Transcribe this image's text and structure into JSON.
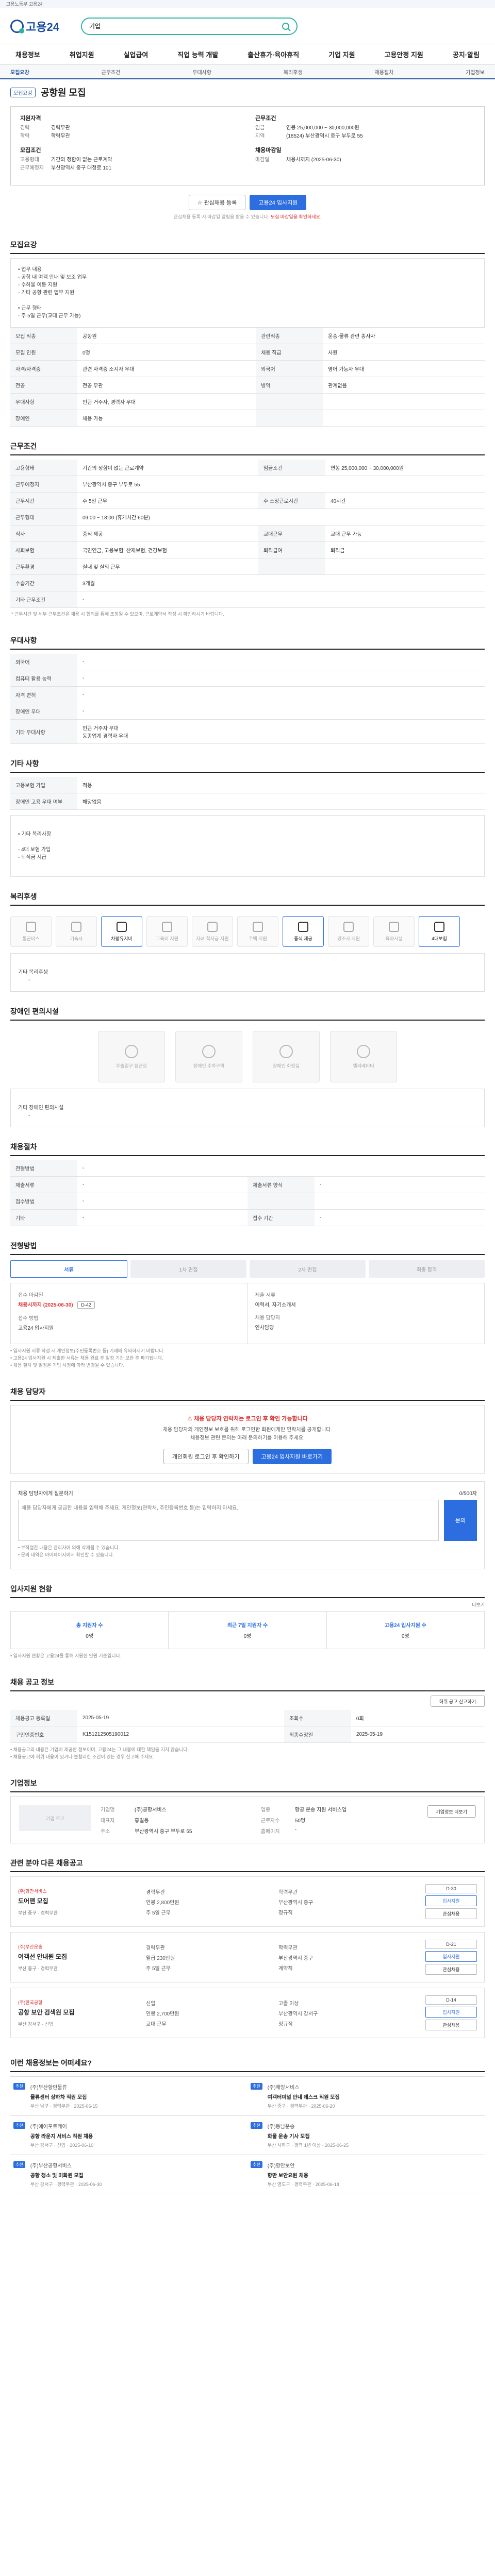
{
  "topbar": {
    "text": "고용노동부 고용24"
  },
  "header": {
    "logo": "고용24",
    "search_placeholder": "기업"
  },
  "nav": [
    "채용정보",
    "취업지원",
    "실업급여",
    "직업 능력 개발",
    "출산휴가·육아휴직",
    "기업 지원",
    "고용안정 지원",
    "공지·알림"
  ],
  "subnav": {
    "items": [
      "모집요강",
      "근무조건",
      "우대사항",
      "복리후생",
      "채용절차",
      "기업정보"
    ],
    "active": 0
  },
  "title": {
    "badge": "모집요강",
    "text": "공항원 모집"
  },
  "summary": {
    "left_title": "지원자격",
    "left": [
      {
        "k": "경력",
        "v": "경력무관"
      },
      {
        "k": "학력",
        "v": "학력무관"
      }
    ],
    "left_title2": "모집조건",
    "left2": [
      {
        "k": "고용형태",
        "v": "기간의 정함이 없는 근로계약"
      },
      {
        "k": "근무예정지",
        "v": "부산광역시 중구 대청로 101"
      }
    ],
    "right_title": "근무조건",
    "right": [
      {
        "k": "임금",
        "v": "연봉 25,000,000 ~ 30,000,000원"
      },
      {
        "k": "지역",
        "v": "(18524) 부산광역시 중구 부두로 55"
      }
    ],
    "right_title2": "채용마감일",
    "right2": [
      {
        "k": "마감일",
        "v": "채용시까지 (2025-06-30)"
      }
    ]
  },
  "actions": {
    "scrap": "관심채용 등록",
    "apply": "고용24 입사지원"
  },
  "apply_note": {
    "pre": "관심채용 등록 시 마감일 알림을 받을 수 있습니다.",
    "red": " 모집 마감일을 확인하세요."
  },
  "recruit": {
    "title": "모집요강",
    "job_desc": "• 업무 내용\n - 공항 내 여객 안내 및 보조 업무\n - 수하물 이동 지원\n - 기타 공항 관련 업무 지원\n\n• 근무 형태\n - 주 5일 근무(교대 근무 가능)",
    "rows": [
      {
        "k": "모집 직종",
        "v": "공항원",
        "k2": "관련직종",
        "v2": "운송·물류 관련 종사자"
      },
      {
        "k": "모집 인원",
        "v": "0명",
        "k2": "채용 직급",
        "v2": "사원"
      },
      {
        "k": "자격/자격증",
        "v": "관련 자격증 소지자 우대",
        "k2": "외국어",
        "v2": "영어 가능자 우대"
      },
      {
        "k": "전공",
        "v": "전공 무관",
        "k2": "병역",
        "v2": "관계없음"
      },
      {
        "k": "우대사항",
        "v": "인근 거주자, 경력자 우대",
        "k2": "",
        "v2": ""
      },
      {
        "k": "장애인",
        "v": "채용 가능",
        "k2": "",
        "v2": ""
      }
    ]
  },
  "conditions": {
    "title": "근무조건",
    "rows": [
      {
        "k": "고용형태",
        "v": "기간의 정함이 없는 근로계약",
        "k2": "임금조건",
        "v2": "연봉 25,000,000 ~ 30,000,000원"
      },
      {
        "k": "근무예정지",
        "v": "부산광역시 중구 부두로 55"
      },
      {
        "k": "근무시간",
        "v": "주 5일 근무",
        "k2": "주 소정근로시간",
        "v2": "40시간"
      },
      {
        "k": "근무형태",
        "v": "09:00 ~ 18:00 (휴게시간 60분)"
      },
      {
        "k": "식사",
        "v": "중식 제공",
        "k2": "교대근무",
        "v2": "교대 근무 가능"
      },
      {
        "k": "사회보험",
        "v": "국민연금, 고용보험, 산재보험, 건강보험",
        "k2": "퇴직급여",
        "v2": "퇴직금"
      },
      {
        "k": "근무환경",
        "v": "실내 및 실외 근무",
        "k2": "",
        "v2": ""
      },
      {
        "k": "수습기간",
        "v": "3개월"
      },
      {
        "k": "기타 근무조건",
        "v": "-"
      }
    ],
    "footnote": "* 근무시간 및 세부 근무조건은 채용 시 협의를 통해 조정될 수 있으며, 근로계약서 작성 시 확인하시기 바랍니다."
  },
  "preferred": {
    "title": "우대사항",
    "rows": [
      {
        "k": "외국어",
        "v": "-"
      },
      {
        "k": "컴퓨터 활용 능력",
        "v": "-"
      },
      {
        "k": "자격 면허",
        "v": "-"
      },
      {
        "k": "장애인 우대",
        "v": "-"
      },
      {
        "k": "기타 우대사항",
        "v": "인근 거주자 우대\n동종업계 경력자 우대"
      }
    ]
  },
  "extra": {
    "title": "기타 사항",
    "rows": [
      {
        "k": "고용보험 가입",
        "v": "적용"
      },
      {
        "k": "장애인 고용 우대 여부",
        "v": "해당없음"
      }
    ],
    "note_label": "• 기타 복리사항",
    "note": "- 4대 보험 가입\n- 퇴직금 지급"
  },
  "welfare": {
    "title": "복리후생",
    "icons": [
      {
        "label": "통근버스",
        "on": false
      },
      {
        "label": "기숙사",
        "on": false
      },
      {
        "label": "차량유지비",
        "on": true
      },
      {
        "label": "교육비 지원",
        "on": false
      },
      {
        "label": "자녀 학자금 지원",
        "on": false
      },
      {
        "label": "주택 지원",
        "on": false
      },
      {
        "label": "중식 제공",
        "on": true
      },
      {
        "label": "경조사 지원",
        "on": false
      },
      {
        "label": "육아시설",
        "on": false
      },
      {
        "label": "4대보험",
        "on": true
      }
    ],
    "extra_label": "기타 복리후생",
    "extra_value": "-"
  },
  "disability": {
    "title": "장애인 편의시설",
    "tiles": [
      "주출입구 접근로",
      "장애인 주차구역",
      "장애인 화장실",
      "엘리베이터"
    ],
    "extra_label": "기타 장애인 편의시설",
    "extra_value": "-"
  },
  "process": {
    "title": "채용절차",
    "rows": [
      {
        "k": "전형방법",
        "v": "-"
      },
      {
        "k": "제출서류",
        "v": "-",
        "k2": "제출서류 양식",
        "v2": "-"
      },
      {
        "k": "접수방법",
        "v": "-",
        "k2": "",
        "v2": ""
      },
      {
        "k": "기타",
        "v": "-",
        "k2": "접수 기간",
        "v2": "-"
      }
    ]
  },
  "apply_steps": {
    "title": "전형방법",
    "steps": [
      "서류",
      "1차 면접",
      "2차 면접",
      "최종 합격"
    ],
    "active": 0,
    "panel": {
      "receipt_label": "접수 마감일",
      "receipt_value": "채용시까지 (2025-06-30)",
      "receipt_remain": "D-42",
      "method_label": "접수 방법",
      "method_value": "고용24 입사지원",
      "doc_label": "제출 서류",
      "doc_value": "이력서, 자기소개서",
      "contact_label": "채용 담당자",
      "contact_value": "인사담당"
    },
    "notes": [
      "• 입사지원 서류 작성 시 개인정보(주민등록번호 등) 기재에 유의하시기 바랍니다.",
      "• 고용24 입사지원 시 제출한 서류는 채용 완료 후 일정 기간 보관 후 파기됩니다.",
      "• 채용 절차 및 일정은 기업 사정에 따라 변경될 수 있습니다."
    ]
  },
  "contact": {
    "title": "채용 담당자",
    "warn_title": "채용 담당자 연락처는 로그인 후 확인 가능합니다",
    "warn_body": "채용 담당자의 개인정보 보호를 위해 로그인한 회원에게만 연락처를 공개합니다.\n채용정보 관련 문의는 아래 문의하기를 이용해 주세요.",
    "btn_login": "개인회원 로그인 후 확인하기",
    "btn_apply": "고용24 입사지원 바로가기"
  },
  "inquiry": {
    "title": "채용 담당자에게 질문하기",
    "counter": "0/500자",
    "placeholder": "채용 담당자에게 궁금한 내용을 입력해 주세요. 개인정보(연락처, 주민등록번호 등)는 입력하지 마세요.",
    "send": "문의",
    "notes": [
      "• 부적절한 내용은 관리자에 의해 삭제될 수 있습니다.",
      "• 문의 내역은 마이페이지에서 확인할 수 있습니다."
    ]
  },
  "apply_methods": {
    "title": "입사지원 현황",
    "more": "더보기",
    "items": [
      {
        "t": "총 지원자 수",
        "v": "0명"
      },
      {
        "t": "최근 7일 지원자 수",
        "v": "0명"
      },
      {
        "t": "고용24 입사지원 수",
        "v": "0명"
      }
    ],
    "note": "• 입사지원 현황은 고용24를 통해 지원한 인원 기준입니다."
  },
  "posting": {
    "title": "채용 공고 정보",
    "report": "허위 공고 신고하기",
    "rows": [
      {
        "k": "채용공고 등록일",
        "v": "2025-05-19",
        "k2": "조회수",
        "v2": "0회"
      },
      {
        "k": "구인인증번호",
        "v": "K151212505190012",
        "k2": "최종수정일",
        "v2": "2025-05-19"
      }
    ],
    "notes": [
      "• 채용공고의 내용은 기업이 제공한 정보이며, 고용24는 그 내용에 대한 책임을 지지 않습니다.",
      "• 채용공고에 허위 내용이 있거나 불합리한 조건이 있는 경우 신고해 주세요."
    ]
  },
  "company": {
    "title": "기업정보",
    "logo": "기업 로고",
    "more_btn": "기업정보 더보기",
    "fields": [
      {
        "k": "기업명",
        "v": "(주)공항서비스"
      },
      {
        "k": "업종",
        "v": "항공 운송 지원 서비스업"
      },
      {
        "k": "대표자",
        "v": "홍길동"
      },
      {
        "k": "근로자수",
        "v": "50명"
      },
      {
        "k": "주소",
        "v": "부산광역시 중구 부두로 55"
      },
      {
        "k": "홈페이지",
        "v": "-"
      }
    ]
  },
  "similar": {
    "title": "관련 분야 다른 채용공고",
    "more": "더보기",
    "jobs": [
      {
        "co": "(주)항만서비스",
        "tt": "도어맨 모집",
        "meta": "부산 중구 · 경력무관",
        "fields": [
          "경력무관",
          "학력무관",
          "연봉 2,800만원",
          "부산광역시 중구",
          "주 5일 근무",
          "정규직"
        ],
        "d": "D-30",
        "btn": "입사지원",
        "scrap": "관심채용"
      },
      {
        "co": "(주)부산운송",
        "tt": "여객선 안내원 모집",
        "meta": "부산 중구 · 경력무관",
        "fields": [
          "경력무관",
          "학력무관",
          "월급 230만원",
          "부산광역시 중구",
          "주 5일 근무",
          "계약직"
        ],
        "d": "D-21",
        "btn": "입사지원",
        "scrap": "관심채용"
      },
      {
        "co": "(주)한국공항",
        "tt": "공항 보안 검색원 모집",
        "meta": "부산 강서구 · 신입",
        "fields": [
          "신입",
          "고졸 이상",
          "연봉 2,700만원",
          "부산광역시 강서구",
          "교대 근무",
          "정규직"
        ],
        "d": "D-14",
        "btn": "입사지원",
        "scrap": "관심채용"
      }
    ]
  },
  "recommend": {
    "title": "이런 채용정보는 어떠세요?",
    "items": [
      {
        "chip": "추천",
        "co": "(주)부산항만물류",
        "tt": "물류센터 상하차 직원 모집",
        "meta": "부산 남구 · 경력무관 · 2025-06-15"
      },
      {
        "chip": "추천",
        "co": "(주)해양서비스",
        "tt": "여객터미널 안내 데스크 직원 모집",
        "meta": "부산 중구 · 경력무관 · 2025-06-20"
      },
      {
        "chip": "추천",
        "co": "(주)에어포트케어",
        "tt": "공항 라운지 서비스 직원 채용",
        "meta": "부산 강서구 · 신입 · 2025-06-10"
      },
      {
        "chip": "추천",
        "co": "(주)동남운송",
        "tt": "화물 운송 기사 모집",
        "meta": "부산 사하구 · 경력 1년 이상 · 2025-06-25"
      },
      {
        "chip": "추천",
        "co": "(주)부산공항서비스",
        "tt": "공항 청소 및 미화원 모집",
        "meta": "부산 강서구 · 경력무관 · 2025-06-30"
      },
      {
        "chip": "추천",
        "co": "(주)항만보안",
        "tt": "항만 보안요원 채용",
        "meta": "부산 영도구 · 경력무관 · 2025-06-18"
      }
    ]
  }
}
